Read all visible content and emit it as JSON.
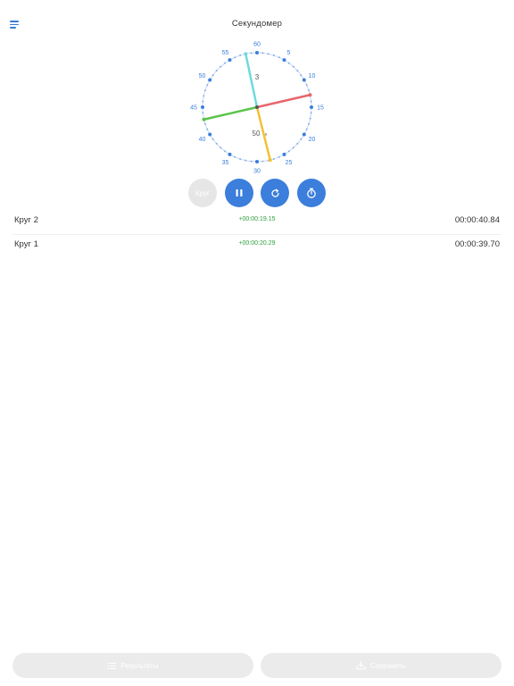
{
  "header": {
    "title": "Секундомер",
    "menu_icon": "hamburger-menu-icon"
  },
  "dial": {
    "tick_labels": [
      "60",
      "5",
      "10",
      "15",
      "20",
      "25",
      "30",
      "35",
      "40",
      "45",
      "50",
      "55"
    ],
    "inner_top_label": "3",
    "inner_bottom_label": "50",
    "inner_bottom_unit": "м",
    "hand_colors": {
      "minutes": "#e8656b",
      "seconds": "#5bc44b",
      "hours": "#f2c233",
      "extra": "#6fd9de"
    },
    "accent": "#3b7edb"
  },
  "controls": {
    "lap_label": "Круг",
    "pause_icon": "pause-icon",
    "reset_icon": "reset-icon",
    "timer_icon": "stopwatch-icon"
  },
  "laps": [
    {
      "label": "Круг  2",
      "diff": "+00:00:19.15",
      "total": "00:00:40.84"
    },
    {
      "label": "Круг  1",
      "diff": "+00:00:20.29",
      "total": "00:00:39.70"
    }
  ],
  "footer": {
    "results_label": "Результаты",
    "save_label": "Сохранить"
  }
}
